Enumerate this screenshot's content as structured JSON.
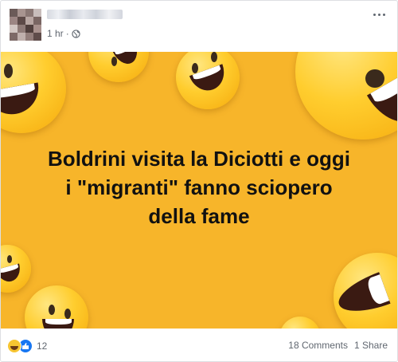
{
  "post": {
    "time": "1 hr",
    "separator": "·",
    "privacy_icon": "globe-icon",
    "more_icon": "ellipsis-icon"
  },
  "image": {
    "caption_lines": [
      "Boldrini visita la Diciotti e oggi",
      "i \"migranti\" fanno sciopero",
      "della fame"
    ],
    "background_color": "#f7b52a"
  },
  "footer": {
    "reaction_icons": [
      "haha-icon",
      "like-icon"
    ],
    "reaction_count": "12",
    "comments": "18 Comments",
    "shares": "1 Share"
  }
}
